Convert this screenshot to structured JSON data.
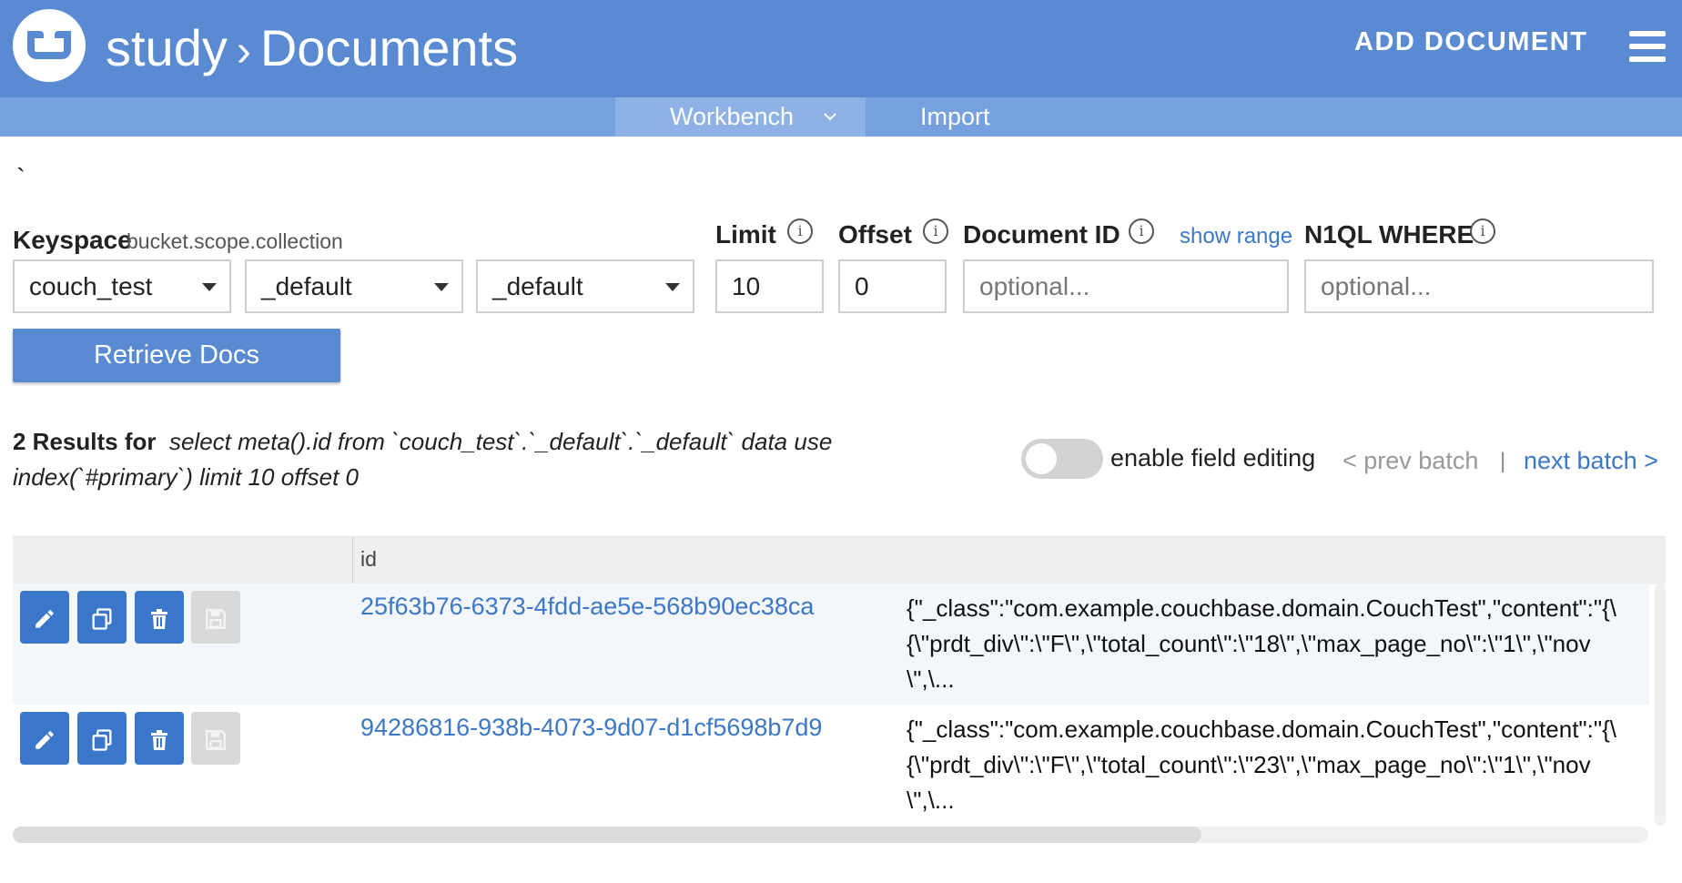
{
  "header": {
    "breadcrumb_root": "study",
    "breadcrumb_sep": "›",
    "breadcrumb_page": "Documents",
    "add_document": "ADD DOCUMENT"
  },
  "subnav": {
    "workbench": "Workbench",
    "import": "Import"
  },
  "stray_char": "`",
  "form": {
    "keyspace_label": "Keyspace",
    "keyspace_hint": "bucket.scope.collection",
    "bucket": "couch_test",
    "scope": "_default",
    "collection": "_default",
    "limit_label": "Limit",
    "limit_value": "10",
    "offset_label": "Offset",
    "offset_value": "0",
    "docid_label": "Document ID",
    "docid_placeholder": "optional...",
    "show_range": "show range",
    "where_label": "N1QL WHERE",
    "where_placeholder": "optional...",
    "retrieve_label": "Retrieve Docs",
    "info_glyph": "i"
  },
  "results": {
    "count_text": "2 Results for",
    "query_text": "select meta().id from `couch_test`.`_default`.`_default` data use index(`#primary`) limit 10 offset 0"
  },
  "controls": {
    "field_editing_label": "enable field editing",
    "field_editing_on": false,
    "prev_batch": "< prev batch",
    "pipe": "|",
    "next_batch": "next batch >"
  },
  "table": {
    "col_id": "id",
    "rows": [
      {
        "id": "25f63b76-6373-4fdd-ae5e-568b90ec38ca",
        "json_line1": "{\"_class\":\"com.example.couchbase.domain.CouchTest\",\"content\":\"{\\",
        "json_line2": "{\\\"prdt_div\\\":\\\"F\\\",\\\"total_count\\\":\\\"18\\\",\\\"max_page_no\\\":\\\"1\\\",\\\"nov",
        "json_line3": "\\\",\\..."
      },
      {
        "id": "94286816-938b-4073-9d07-d1cf5698b7d9",
        "json_line1": "{\"_class\":\"com.example.couchbase.domain.CouchTest\",\"content\":\"{\\",
        "json_line2": "{\\\"prdt_div\\\":\\\"F\\\",\\\"total_count\\\":\\\"23\\\",\\\"max_page_no\\\":\\\"1\\\",\\\"nov",
        "json_line3": "\\\",\\..."
      }
    ]
  },
  "colors": {
    "header_bg": "#5a8bd2",
    "subnav_bg": "#76a0de",
    "link": "#3c78c7",
    "button": "#3a76c9"
  }
}
